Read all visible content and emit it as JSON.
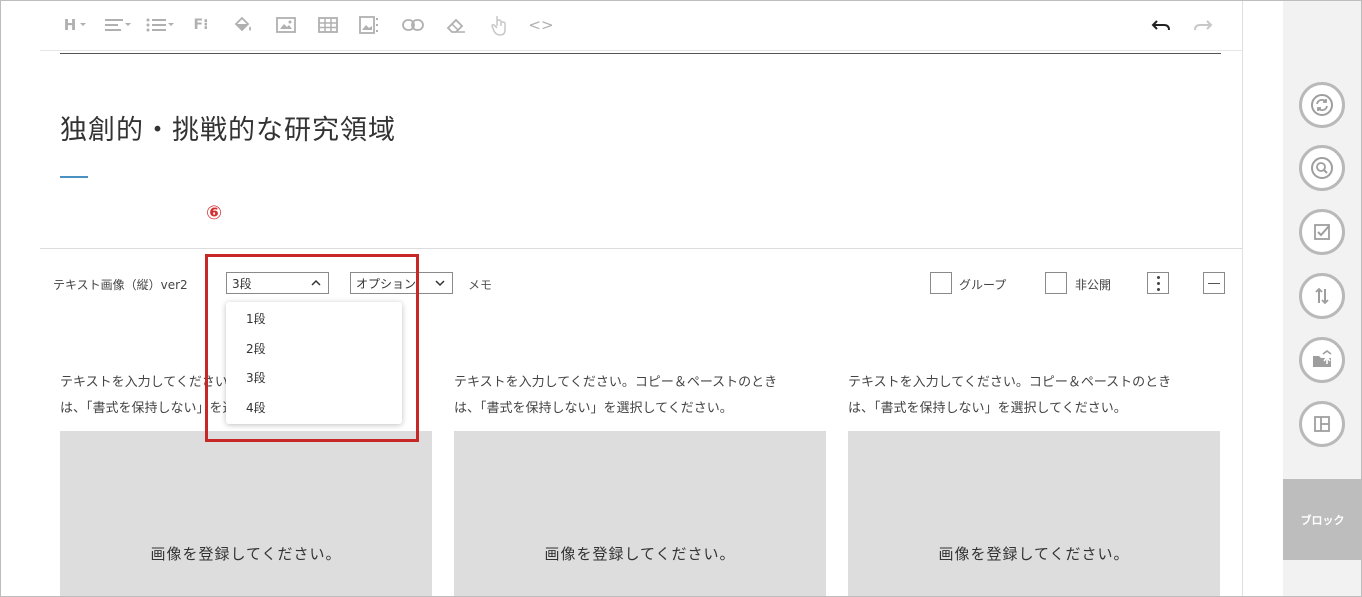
{
  "toolbar": {
    "heading_glyph": "H",
    "format_glyph": "F⁝",
    "code_glyph": "<>",
    "icons": [
      "heading-icon",
      "align-icon",
      "list-icon",
      "format-icon",
      "paint-bucket-icon",
      "image-icon",
      "table-icon",
      "image-grid-icon",
      "link-icon",
      "eraser-icon",
      "hand-pointer-icon",
      "code-icon",
      "undo-icon",
      "redo-icon"
    ]
  },
  "page": {
    "title": "独創的・挑戦的な研究領域",
    "annotation_number": "⑥"
  },
  "block": {
    "label": "テキスト画像（縦）ver2",
    "columns_select": {
      "value": "3段",
      "options": [
        "1段",
        "2段",
        "3段",
        "4段"
      ]
    },
    "option_select": {
      "value": "オプション"
    },
    "memo": "メモ",
    "group_label": "グループ",
    "private_label": "非公開"
  },
  "columns": [
    {
      "text_line1": "テキストを入力してください。コピー＆ペーストのとき",
      "text_line2": "は、「書式を保持しない」を選択してください。",
      "image_placeholder": "画像を登録してください。"
    },
    {
      "text_line1": "テキストを入力してください。コピー＆ペーストのとき",
      "text_line2": "は、「書式を保持しない」を選択してください。",
      "image_placeholder": "画像を登録してください。"
    },
    {
      "text_line1": "テキストを入力してください。コピー＆ペーストのとき",
      "text_line2": "は、「書式を保持しない」を選択してください。",
      "image_placeholder": "画像を登録してください。"
    }
  ],
  "sidebar": {
    "icons": [
      "refresh-icon",
      "zoom-icon",
      "checkbox-icon",
      "sort-icon",
      "folder-upload-icon",
      "layout-icon"
    ],
    "block_label": "ブロック"
  },
  "colors": {
    "highlight": "#c62828",
    "title_accent": "#4a90c0",
    "placeholder_bg": "#dddddd",
    "sidebar_bg": "#f2f2f2"
  }
}
